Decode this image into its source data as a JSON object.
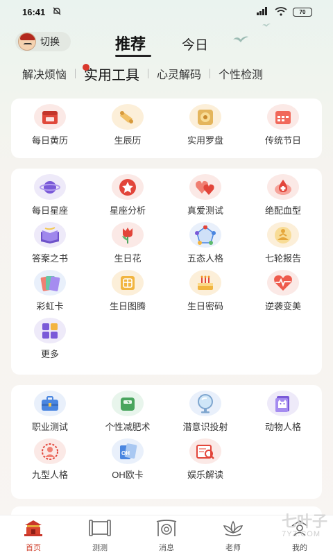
{
  "status": {
    "time": "16:41",
    "battery": "70"
  },
  "header": {
    "switch_label": "切换",
    "tabs": [
      {
        "label": "推荐"
      },
      {
        "label": "今日"
      }
    ]
  },
  "subtabs": [
    "解决烦恼",
    "实用工具",
    "心灵解码",
    "个性检测"
  ],
  "card1": {
    "items": [
      {
        "label": "每日黄历",
        "icon": "calendar-red-icon"
      },
      {
        "label": "生辰历",
        "icon": "scroll-icon"
      },
      {
        "label": "实用罗盘",
        "icon": "compass-icon"
      },
      {
        "label": "传统节日",
        "icon": "festival-calendar-icon"
      }
    ]
  },
  "card2": {
    "items": [
      {
        "label": "每日星座",
        "icon": "planet-icon"
      },
      {
        "label": "星座分析",
        "icon": "star-badge-icon"
      },
      {
        "label": "真爱测试",
        "icon": "hearts-icon"
      },
      {
        "label": "绝配血型",
        "icon": "blood-drop-icon"
      },
      {
        "label": "答案之书",
        "icon": "book-icon"
      },
      {
        "label": "生日花",
        "icon": "tulip-icon"
      },
      {
        "label": "五态人格",
        "icon": "network-icon"
      },
      {
        "label": "七轮报告",
        "icon": "meditation-icon"
      },
      {
        "label": "彩虹卡",
        "icon": "rainbow-card-icon"
      },
      {
        "label": "生日图腾",
        "icon": "totem-icon"
      },
      {
        "label": "生日密码",
        "icon": "cake-icon"
      },
      {
        "label": "逆袭变美",
        "icon": "heart-pulse-icon"
      },
      {
        "label": "更多",
        "icon": "more-grid-icon"
      }
    ]
  },
  "card3": {
    "items": [
      {
        "label": "职业测试",
        "icon": "briefcase-icon"
      },
      {
        "label": "个性减肥术",
        "icon": "scale-icon"
      },
      {
        "label": "潜意识投射",
        "icon": "mirror-icon"
      },
      {
        "label": "动物人格",
        "icon": "cat-card-icon"
      },
      {
        "label": "九型人格",
        "icon": "enneagram-icon"
      },
      {
        "label": "OH欧卡",
        "icon": "oh-card-icon"
      },
      {
        "label": "娱乐解读",
        "icon": "magnifier-book-icon"
      }
    ]
  },
  "nav": [
    {
      "label": "首页",
      "icon": "palace-icon"
    },
    {
      "label": "测测",
      "icon": "scroll-frame-icon"
    },
    {
      "label": "消息",
      "icon": "gong-icon"
    },
    {
      "label": "老师",
      "icon": "lotus-icon"
    },
    {
      "label": "我的",
      "icon": "profile-icon"
    }
  ],
  "watermark": {
    "title": "七叶子",
    "sub": "7YZ.COM"
  },
  "colors": {
    "accent": "#d0432f",
    "background": "#f6f3ef"
  }
}
